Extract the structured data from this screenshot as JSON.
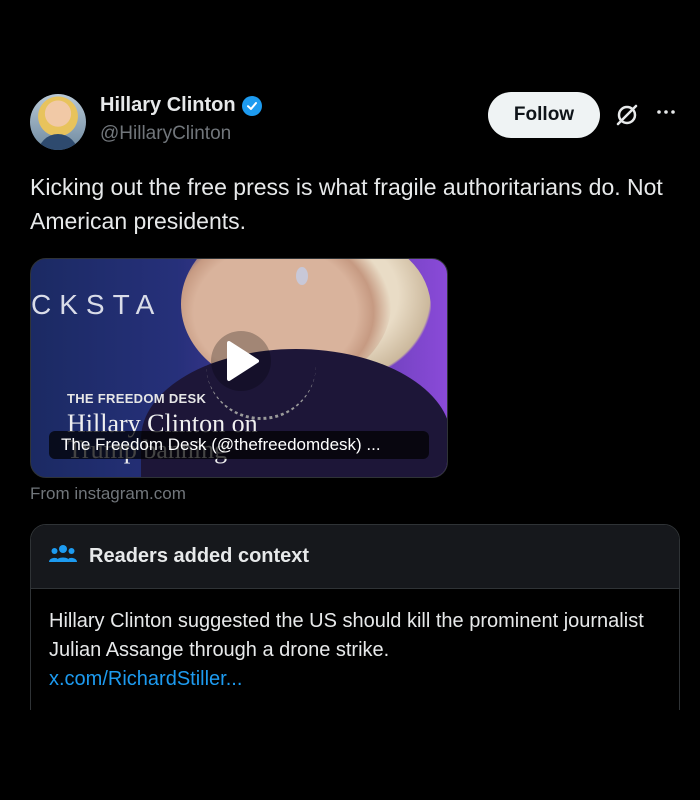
{
  "author": {
    "display_name": "Hillary Clinton",
    "handle": "@HillaryClinton",
    "verified": true
  },
  "actions": {
    "follow_label": "Follow",
    "grok_icon": "grok-icon",
    "more_icon": "more-icon"
  },
  "post": {
    "text": "Kicking out the free press is what fragile authoritarians do. Not American presidents."
  },
  "media": {
    "brand_text": "CKSTA",
    "desk_label": "THE FREEDOM DESK",
    "headline": "Hillary Clinton on Trump banning",
    "caption": "The Freedom Desk (@thefreedomdesk) ...",
    "play_icon": "play-icon",
    "source": "From instagram.com"
  },
  "context": {
    "title": "Readers added context",
    "body": "Hillary Clinton suggested the US should kill the prominent journalist Julian Assange through a drone strike.",
    "link": "x.com/RichardStiller..."
  },
  "colors": {
    "background": "#000000",
    "accent": "#1d9bf0",
    "text_primary": "#e7e9ea",
    "text_secondary": "#71767b",
    "follow_button_bg": "#eff3f4"
  }
}
